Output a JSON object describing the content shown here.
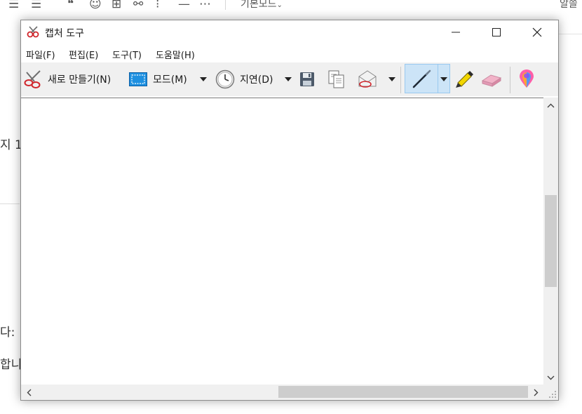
{
  "background_editor": {
    "toolbar_mode_label": "기본모드",
    "toolbar_right_label": "알쓸",
    "text_fragments": [
      "지 1",
      "다:",
      "합니"
    ]
  },
  "window": {
    "title": "캡처 도구",
    "menu": [
      "파일(F)",
      "편집(E)",
      "도구(T)",
      "도움말(H)"
    ],
    "toolbar": {
      "new_label": "새로 만들기(N)",
      "mode_label": "모드(M)",
      "delay_label": "지연(D)"
    }
  }
}
